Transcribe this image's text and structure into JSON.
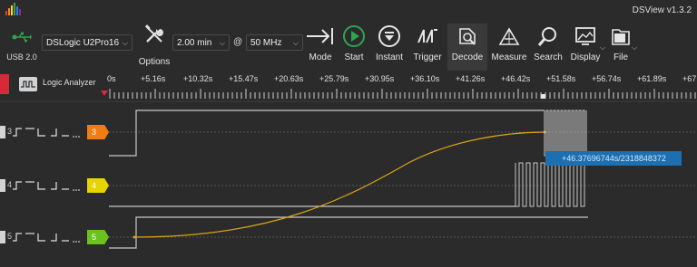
{
  "app": {
    "title": "DSView v1.3.2"
  },
  "colors": {
    "accent_red": "#d8293a",
    "ch3": "#f07d14",
    "ch4": "#e6d300",
    "ch5": "#6cc21c",
    "trace": "#c8c8c8",
    "curve": "#d9a418",
    "readout_bg": "#1c6fb0"
  },
  "toolbar": {
    "usb_label": "USB 2.0",
    "device": "DSLogic U2Pro16",
    "options_label": "Options",
    "duration": "2.00 min",
    "at": "@",
    "samplerate": "50 MHz",
    "buttons": [
      {
        "label": "Mode",
        "icon": "mode-icon"
      },
      {
        "label": "Start",
        "icon": "start-icon"
      },
      {
        "label": "Instant",
        "icon": "instant-icon"
      },
      {
        "label": "Trigger",
        "icon": "trigger-icon"
      },
      {
        "label": "Decode",
        "icon": "decode-icon"
      },
      {
        "label": "Measure",
        "icon": "measure-icon"
      },
      {
        "label": "Search",
        "icon": "search-icon"
      },
      {
        "label": "Display",
        "icon": "display-icon"
      },
      {
        "label": "File",
        "icon": "file-icon"
      }
    ]
  },
  "ruler": {
    "label": "Logic Analyzer",
    "ticks": [
      "0s",
      "+5.16s",
      "+10.32s",
      "+15.47s",
      "+20.63s",
      "+25.79s",
      "+30.95s",
      "+36.10s",
      "+41.26s",
      "+46.42s",
      "+51.58s",
      "+56.74s",
      "+61.89s",
      "+67"
    ]
  },
  "channels": [
    {
      "num": "3",
      "tag": "3"
    },
    {
      "num": "4",
      "tag": "4"
    },
    {
      "num": "5",
      "tag": "5"
    }
  ],
  "readout": "+46.37696744s/2318848372"
}
